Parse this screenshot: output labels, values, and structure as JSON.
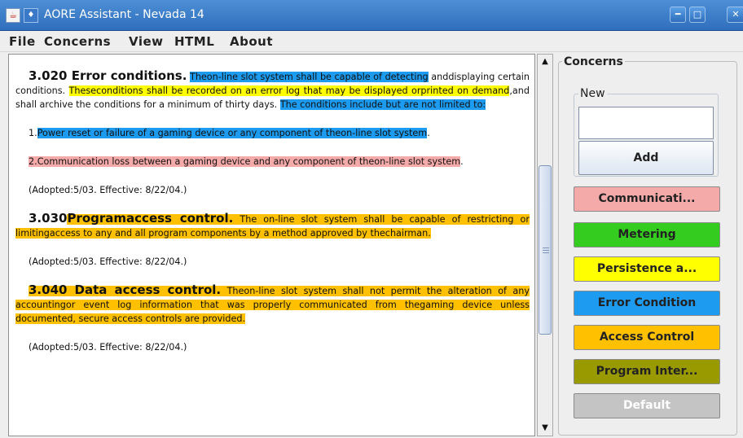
{
  "window": {
    "title": "AORE Assistant - Nevada 14",
    "icons": [
      "java-icon",
      "window-menu-icon",
      "minimize-icon",
      "maximize-icon",
      "close-icon"
    ]
  },
  "menu": {
    "file": "File",
    "concerns": "Concerns",
    "view": "View",
    "html": "HTML",
    "about": "About"
  },
  "document": {
    "s1": {
      "heading": "3.020 Error conditions.",
      "text1": "Theon-line slot system shall be capable of detecting",
      "text2": "anddisplaying certain conditions.",
      "text3": "Theseconditions shall be recorded on an error log that may be displayed orprinted on demand",
      "text4": ",and shall archive the conditions for a minimum of thirty days.",
      "text5": "The conditions include but are not limited to:"
    },
    "item1": {
      "num": "1.",
      "text": "Power reset or failure of a gaming device or any component of theon-line slot system",
      "end": "."
    },
    "item2": {
      "num": "2.",
      "text": "Communication loss between a gaming device and any component of theon-line slot system",
      "end": "."
    },
    "adopted1": "(Adopted:5/03. Effective: 8/22/04.)",
    "s2": {
      "num": "3.030",
      "heading": "Programaccess control.",
      "text": "The on-line slot system shall be capable of restricting or limitingaccess to any and all program components by a method approved by thechairman."
    },
    "adopted2": "(Adopted:5/03. Effective: 8/22/04.)",
    "s3": {
      "heading": "3.040 Data access control.",
      "text": "Theon-line slot system shall not permit the alteration of any accountingor event log information that was properly communicated from thegaming device unless documented, secure access controls are provided."
    },
    "adopted3": "(Adopted:5/03. Effective: 8/22/04.)"
  },
  "concerns": {
    "title": "Concerns",
    "new_title": "New",
    "new_value": "",
    "add_label": "Add",
    "buttons": [
      {
        "label": "Communicati...",
        "bg": "#f5aaaa",
        "fg": "#222222"
      },
      {
        "label": "Metering",
        "bg": "#33cc1f",
        "fg": "#222222"
      },
      {
        "label": "Persistence a...",
        "bg": "#ffff00",
        "fg": "#222222"
      },
      {
        "label": "Error Condition",
        "bg": "#1d9bf0",
        "fg": "#222222"
      },
      {
        "label": "Access Control",
        "bg": "#ffc000",
        "fg": "#222222"
      },
      {
        "label": "Program Inter...",
        "bg": "#999900",
        "fg": "#222222"
      },
      {
        "label": "Default",
        "bg": "#c4c4c4",
        "fg": "#ffffff"
      }
    ]
  }
}
